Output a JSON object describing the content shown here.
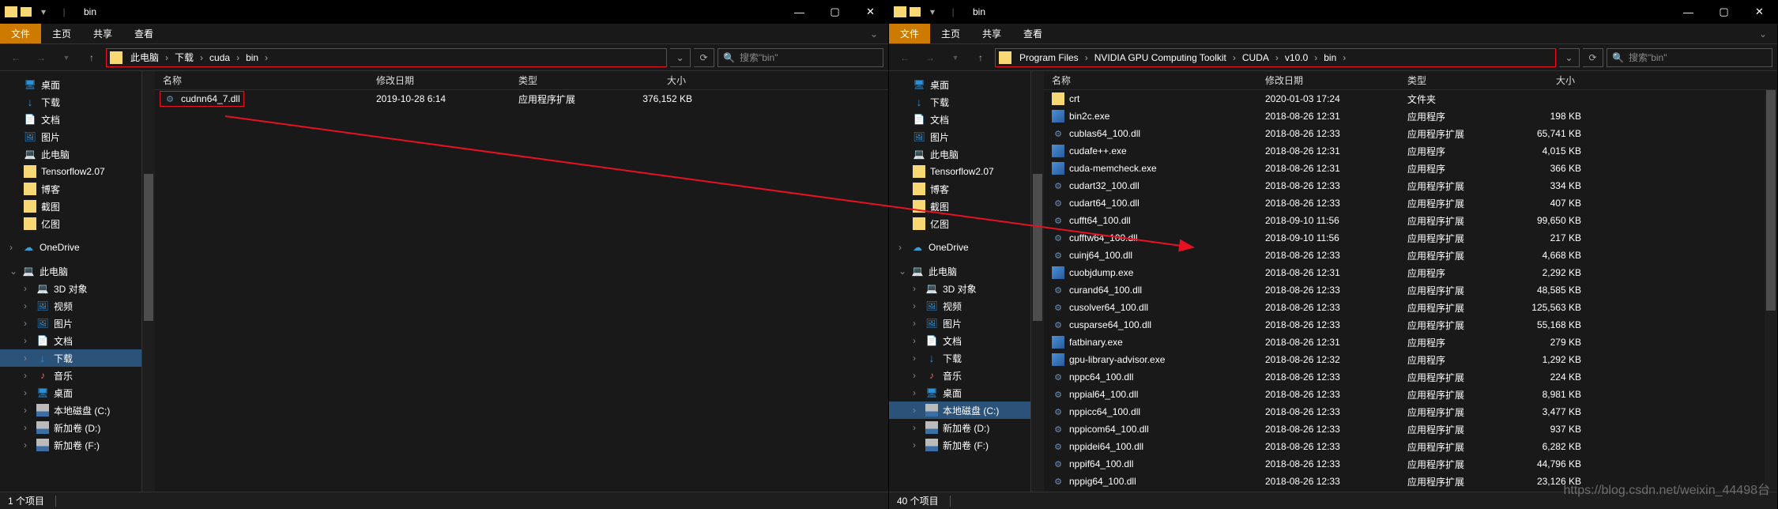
{
  "watermark": "https://blog.csdn.net/weixin_44498台",
  "left": {
    "title": "bin",
    "tabs": {
      "file": "文件",
      "home": "主页",
      "share": "共享",
      "view": "查看"
    },
    "breadcrumbs": [
      "此电脑",
      "下载",
      "cuda",
      "bin"
    ],
    "search_placeholder": "搜索\"bin\"",
    "columns": {
      "name": "名称",
      "date": "修改日期",
      "type": "类型",
      "size": "大小"
    },
    "sidebar": {
      "quick": [
        {
          "label": "桌面",
          "icon": "desktop"
        },
        {
          "label": "下载",
          "icon": "download"
        },
        {
          "label": "文档",
          "icon": "docs"
        },
        {
          "label": "图片",
          "icon": "pics"
        },
        {
          "label": "此电脑",
          "icon": "pc"
        },
        {
          "label": "Tensorflow2.07",
          "icon": "folder"
        },
        {
          "label": "博客",
          "icon": "folder"
        },
        {
          "label": "截图",
          "icon": "folder"
        },
        {
          "label": "亿图",
          "icon": "folder"
        }
      ],
      "onedrive": "OneDrive",
      "thispc": "此电脑",
      "pc_items": [
        {
          "label": "3D 对象",
          "icon": "pc"
        },
        {
          "label": "视频",
          "icon": "pics"
        },
        {
          "label": "图片",
          "icon": "pics"
        },
        {
          "label": "文档",
          "icon": "docs"
        },
        {
          "label": "下载",
          "icon": "download",
          "selected": true
        },
        {
          "label": "音乐",
          "icon": "music"
        },
        {
          "label": "桌面",
          "icon": "desktop"
        },
        {
          "label": "本地磁盘 (C:)",
          "icon": "drive"
        },
        {
          "label": "新加卷 (D:)",
          "icon": "drive"
        },
        {
          "label": "新加卷 (F:)",
          "icon": "drive"
        }
      ]
    },
    "files": [
      {
        "name": "cudnn64_7.dll",
        "date": "2019-10-28 6:14",
        "type": "应用程序扩展",
        "size": "376,152 KB",
        "icon": "gear",
        "highlight": true
      }
    ],
    "status": "1 个项目"
  },
  "right": {
    "title": "bin",
    "tabs": {
      "file": "文件",
      "home": "主页",
      "share": "共享",
      "view": "查看"
    },
    "breadcrumbs": [
      "Program Files",
      "NVIDIA GPU Computing Toolkit",
      "CUDA",
      "v10.0",
      "bin"
    ],
    "search_placeholder": "搜索\"bin\"",
    "columns": {
      "name": "名称",
      "date": "修改日期",
      "type": "类型",
      "size": "大小"
    },
    "sidebar": {
      "quick": [
        {
          "label": "桌面",
          "icon": "desktop"
        },
        {
          "label": "下载",
          "icon": "download"
        },
        {
          "label": "文档",
          "icon": "docs"
        },
        {
          "label": "图片",
          "icon": "pics"
        },
        {
          "label": "此电脑",
          "icon": "pc"
        },
        {
          "label": "Tensorflow2.07",
          "icon": "folder"
        },
        {
          "label": "博客",
          "icon": "folder"
        },
        {
          "label": "截图",
          "icon": "folder"
        },
        {
          "label": "亿图",
          "icon": "folder"
        }
      ],
      "onedrive": "OneDrive",
      "thispc": "此电脑",
      "pc_items": [
        {
          "label": "3D 对象",
          "icon": "pc"
        },
        {
          "label": "视频",
          "icon": "pics"
        },
        {
          "label": "图片",
          "icon": "pics"
        },
        {
          "label": "文档",
          "icon": "docs"
        },
        {
          "label": "下载",
          "icon": "download"
        },
        {
          "label": "音乐",
          "icon": "music"
        },
        {
          "label": "桌面",
          "icon": "desktop"
        },
        {
          "label": "本地磁盘 (C:)",
          "icon": "drive",
          "selected": true
        },
        {
          "label": "新加卷 (D:)",
          "icon": "drive"
        },
        {
          "label": "新加卷 (F:)",
          "icon": "drive"
        }
      ]
    },
    "files": [
      {
        "name": "crt",
        "date": "2020-01-03 17:24",
        "type": "文件夹",
        "size": "",
        "icon": "fldr"
      },
      {
        "name": "bin2c.exe",
        "date": "2018-08-26 12:31",
        "type": "应用程序",
        "size": "198 KB",
        "icon": "exe"
      },
      {
        "name": "cublas64_100.dll",
        "date": "2018-08-26 12:33",
        "type": "应用程序扩展",
        "size": "65,741 KB",
        "icon": "gear"
      },
      {
        "name": "cudafe++.exe",
        "date": "2018-08-26 12:31",
        "type": "应用程序",
        "size": "4,015 KB",
        "icon": "exe"
      },
      {
        "name": "cuda-memcheck.exe",
        "date": "2018-08-26 12:31",
        "type": "应用程序",
        "size": "366 KB",
        "icon": "exe"
      },
      {
        "name": "cudart32_100.dll",
        "date": "2018-08-26 12:33",
        "type": "应用程序扩展",
        "size": "334 KB",
        "icon": "gear"
      },
      {
        "name": "cudart64_100.dll",
        "date": "2018-08-26 12:33",
        "type": "应用程序扩展",
        "size": "407 KB",
        "icon": "gear"
      },
      {
        "name": "cufft64_100.dll",
        "date": "2018-09-10 11:56",
        "type": "应用程序扩展",
        "size": "99,650 KB",
        "icon": "gear"
      },
      {
        "name": "cufftw64_100.dll",
        "date": "2018-09-10 11:56",
        "type": "应用程序扩展",
        "size": "217 KB",
        "icon": "gear"
      },
      {
        "name": "cuinj64_100.dll",
        "date": "2018-08-26 12:33",
        "type": "应用程序扩展",
        "size": "4,668 KB",
        "icon": "gear"
      },
      {
        "name": "cuobjdump.exe",
        "date": "2018-08-26 12:31",
        "type": "应用程序",
        "size": "2,292 KB",
        "icon": "exe"
      },
      {
        "name": "curand64_100.dll",
        "date": "2018-08-26 12:33",
        "type": "应用程序扩展",
        "size": "48,585 KB",
        "icon": "gear"
      },
      {
        "name": "cusolver64_100.dll",
        "date": "2018-08-26 12:33",
        "type": "应用程序扩展",
        "size": "125,563 KB",
        "icon": "gear"
      },
      {
        "name": "cusparse64_100.dll",
        "date": "2018-08-26 12:33",
        "type": "应用程序扩展",
        "size": "55,168 KB",
        "icon": "gear"
      },
      {
        "name": "fatbinary.exe",
        "date": "2018-08-26 12:31",
        "type": "应用程序",
        "size": "279 KB",
        "icon": "exe"
      },
      {
        "name": "gpu-library-advisor.exe",
        "date": "2018-08-26 12:32",
        "type": "应用程序",
        "size": "1,292 KB",
        "icon": "exe"
      },
      {
        "name": "nppc64_100.dll",
        "date": "2018-08-26 12:33",
        "type": "应用程序扩展",
        "size": "224 KB",
        "icon": "gear"
      },
      {
        "name": "nppial64_100.dll",
        "date": "2018-08-26 12:33",
        "type": "应用程序扩展",
        "size": "8,981 KB",
        "icon": "gear"
      },
      {
        "name": "nppicc64_100.dll",
        "date": "2018-08-26 12:33",
        "type": "应用程序扩展",
        "size": "3,477 KB",
        "icon": "gear"
      },
      {
        "name": "nppicom64_100.dll",
        "date": "2018-08-26 12:33",
        "type": "应用程序扩展",
        "size": "937 KB",
        "icon": "gear"
      },
      {
        "name": "nppidei64_100.dll",
        "date": "2018-08-26 12:33",
        "type": "应用程序扩展",
        "size": "6,282 KB",
        "icon": "gear"
      },
      {
        "name": "nppif64_100.dll",
        "date": "2018-08-26 12:33",
        "type": "应用程序扩展",
        "size": "44,796 KB",
        "icon": "gear"
      },
      {
        "name": "nppig64_100.dll",
        "date": "2018-08-26 12:33",
        "type": "应用程序扩展",
        "size": "23,126 KB",
        "icon": "gear"
      }
    ],
    "status": "40 个项目"
  }
}
